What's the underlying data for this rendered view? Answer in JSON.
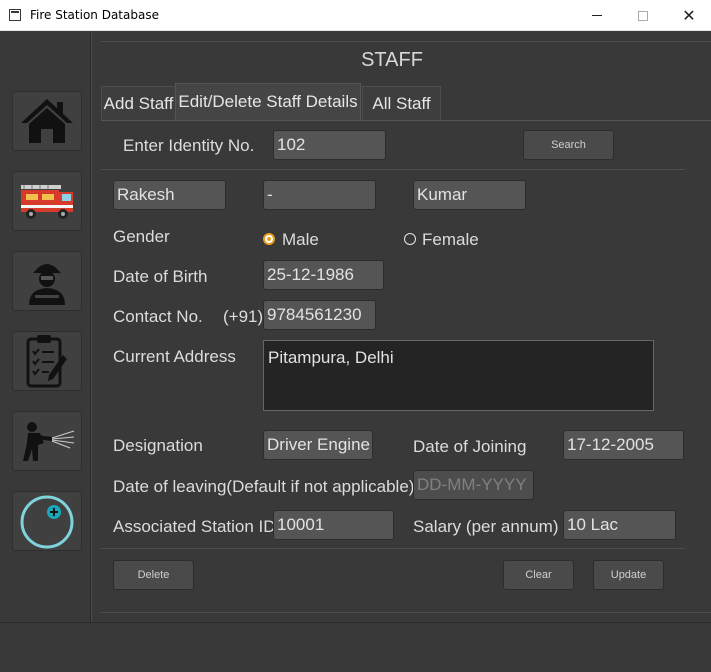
{
  "window": {
    "title": "Fire Station Database"
  },
  "sidebar": {
    "items": [
      {
        "icon": "home-icon"
      },
      {
        "icon": "fire-truck-icon"
      },
      {
        "icon": "firefighter-icon"
      },
      {
        "icon": "clipboard-icon"
      },
      {
        "icon": "fire-hose-icon"
      },
      {
        "icon": "add-circle-icon"
      }
    ]
  },
  "header": {
    "title": "STAFF"
  },
  "tabs": [
    {
      "label": "Add Staff",
      "active": false
    },
    {
      "label": "Edit/Delete Staff Details",
      "active": true
    },
    {
      "label": "All Staff",
      "active": false
    }
  ],
  "search": {
    "label": "Enter Identity No.",
    "value": "102",
    "button_label": "Search"
  },
  "name": {
    "first": "Rakesh",
    "middle": "-",
    "last": "Kumar"
  },
  "gender": {
    "label": "Gender",
    "options": [
      "Male",
      "Female"
    ],
    "selected": "Male"
  },
  "dob": {
    "label": "Date of Birth",
    "value": "25-12-1986"
  },
  "contact": {
    "label": "Contact No.",
    "prefix": "(+91)",
    "value": "9784561230"
  },
  "address": {
    "label": "Current Address",
    "value": "Pitampura, Delhi"
  },
  "designation": {
    "label": "Designation",
    "value": "Driver Engine"
  },
  "joining": {
    "label": "Date of Joining",
    "value": "17-12-2005"
  },
  "leaving": {
    "label": "Date of leaving(Default if not applicable)",
    "placeholder": "DD-MM-YYYY"
  },
  "station": {
    "label": "Associated Station ID",
    "value": "10001"
  },
  "salary": {
    "label": "Salary (per annum)",
    "value": "10 Lac"
  },
  "actions": {
    "delete_label": "Delete",
    "clear_label": "Clear",
    "update_label": "Update"
  },
  "colors": {
    "background": "#393939",
    "field": "#555555",
    "accent": "#e8a020",
    "teal": "#7ed3dc"
  }
}
